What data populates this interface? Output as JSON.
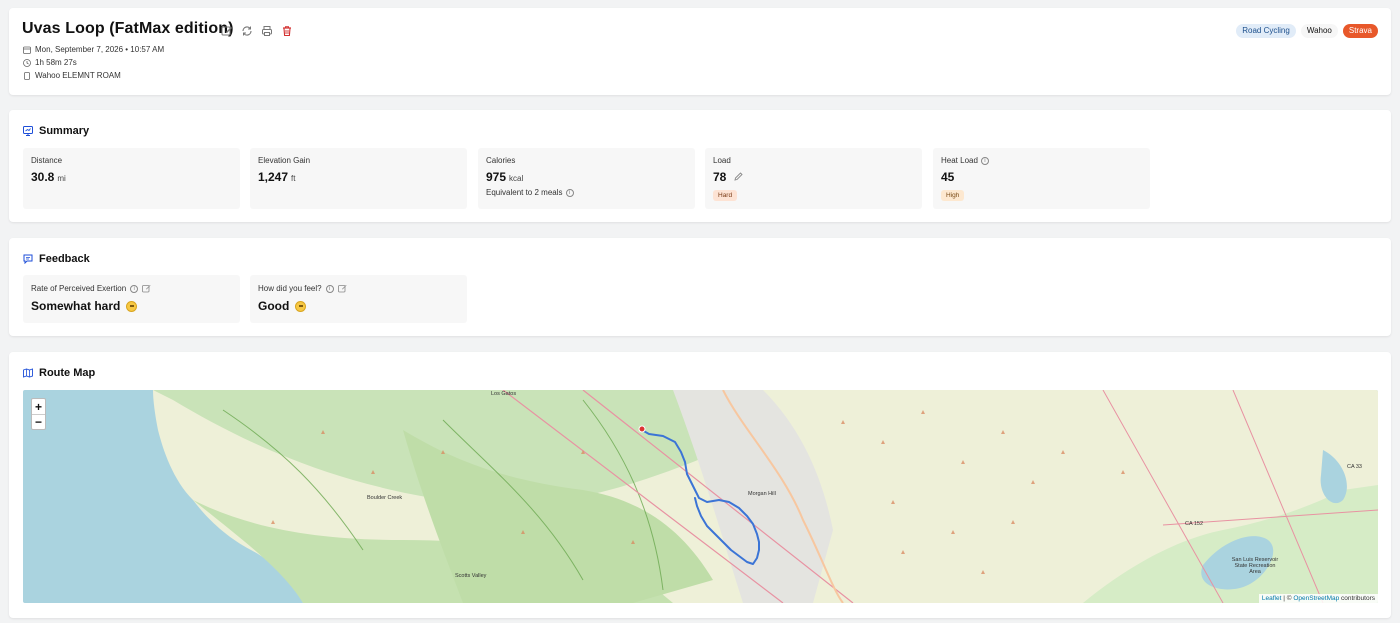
{
  "activity": {
    "title": "Uvas Loop (FatMax edition)",
    "date": "Mon, September 7, 2026 • 10:57 AM",
    "duration": "1h 58m 27s",
    "device": "Wahoo ELEMNT ROAM",
    "badges": {
      "type": "Road Cycling",
      "source": "Wahoo",
      "strava": "Strava"
    }
  },
  "summary": {
    "title": "Summary",
    "distance": {
      "label": "Distance",
      "value": "30.8",
      "unit": "mi"
    },
    "elevation": {
      "label": "Elevation Gain",
      "value": "1,247",
      "unit": "ft"
    },
    "calories": {
      "label": "Calories",
      "value": "975",
      "unit": "kcal",
      "sub": "Equivalent to 2 meals"
    },
    "load": {
      "label": "Load",
      "value": "78",
      "level": "Hard"
    },
    "heat": {
      "label": "Heat Load",
      "value": "45",
      "level": "High"
    }
  },
  "feedback": {
    "title": "Feedback",
    "rpe": {
      "label": "Rate of Perceived Exertion",
      "value": "Somewhat hard"
    },
    "feel": {
      "label": "How did you feel?",
      "value": "Good"
    }
  },
  "map": {
    "title": "Route Map",
    "zoom_in": "+",
    "zoom_out": "−",
    "attribution": {
      "leaflet": "Leaflet",
      "sep": " | © ",
      "osm": "OpenStreetMap",
      "tail": " contributors"
    },
    "places": {
      "los_gatos": "Los Gatos",
      "boulder_creek": "Boulder Creek",
      "scotts_valley": "Scotts Valley",
      "morgan_hill": "Morgan Hill",
      "ca33": "CA 33",
      "ca152": "CA 152",
      "san_luis": "San Luis Reservoir State Recreation Area"
    }
  },
  "colors": {
    "accent": "#1d4ed8",
    "strava": "#e8582a",
    "route": "#3b74d6"
  }
}
